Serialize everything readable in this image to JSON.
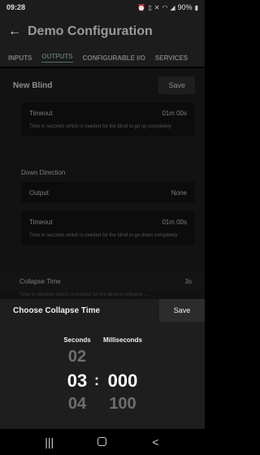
{
  "status_bar": {
    "time": "09:28",
    "battery": "90%",
    "icons": [
      "alarm-icon",
      "vibrate-icon",
      "mute-icon",
      "wifi-icon",
      "signal-icon",
      "battery-icon"
    ]
  },
  "app_bar": {
    "title": "Demo Configuration"
  },
  "tabs": [
    {
      "label": "INPUTS"
    },
    {
      "label": "OUTPUTS"
    },
    {
      "label": "CONFIGURABLE I/O"
    },
    {
      "label": "SERVICES"
    }
  ],
  "section": {
    "title": "New Blind",
    "save_label": "Save"
  },
  "timeout1": {
    "label": "Timeout",
    "value": "01m 00s",
    "description": "Time in seconds which is needed for the blind to go up completely"
  },
  "down_direction": {
    "title": "Down Direction"
  },
  "output": {
    "label": "Output",
    "value": "None"
  },
  "timeout2": {
    "label": "Timeout",
    "value": "01m 00s",
    "description": "Time in seconds which is needed for the blind to go down completely"
  },
  "collapse_time": {
    "label": "Collapse Time",
    "value": "3s",
    "description": "Time in seconds which is needed for the blind to collapse ..."
  },
  "sheet": {
    "title": "Choose Collapse Time",
    "save_label": "Save",
    "seconds_label": "Seconds",
    "ms_label": "Milliseconds",
    "seconds": {
      "prev": "02",
      "selected": "03",
      "next": "04"
    },
    "ms": {
      "selected": "000",
      "next": "100"
    },
    "separator": ":"
  },
  "nav": {
    "recent": "|||",
    "home": "",
    "back": "<"
  }
}
